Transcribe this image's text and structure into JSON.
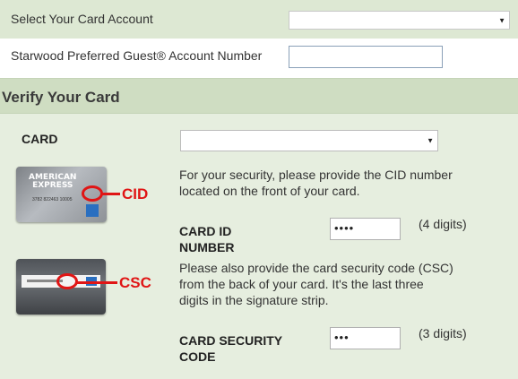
{
  "account_row": {
    "label": "Select Your Card Account",
    "selected": ""
  },
  "spg_row": {
    "label": "Starwood Preferred Guest® Account Number",
    "value": ""
  },
  "verify": {
    "title": "Verify Your Card",
    "card_label": "CARD",
    "card_selected": "",
    "cid_info": [
      "For your security, please provide the CID number",
      "located on the front of your card."
    ],
    "cid_label": [
      "CARD ID",
      "NUMBER"
    ],
    "cid_value": "••••",
    "cid_hint": "(4 digits)",
    "csc_info": [
      "Please also provide the card security code (CSC)",
      "from the back of your card. It's the last three",
      "digits in the signature strip."
    ],
    "csc_label": [
      "CARD SECURITY",
      "CODE"
    ],
    "csc_value": "•••",
    "csc_hint": "(3 digits)"
  },
  "card_images": {
    "front_brand": [
      "AMERICAN",
      "EXPRESS"
    ],
    "front_callout": "CID",
    "back_callout": "CSC"
  },
  "icons": {
    "dropdown": "chevron-down-icon"
  },
  "colors": {
    "header_green": "#cfddc2",
    "body_green": "#e6eedf",
    "row_green": "#dde8d3",
    "callout_red": "#e01515"
  }
}
